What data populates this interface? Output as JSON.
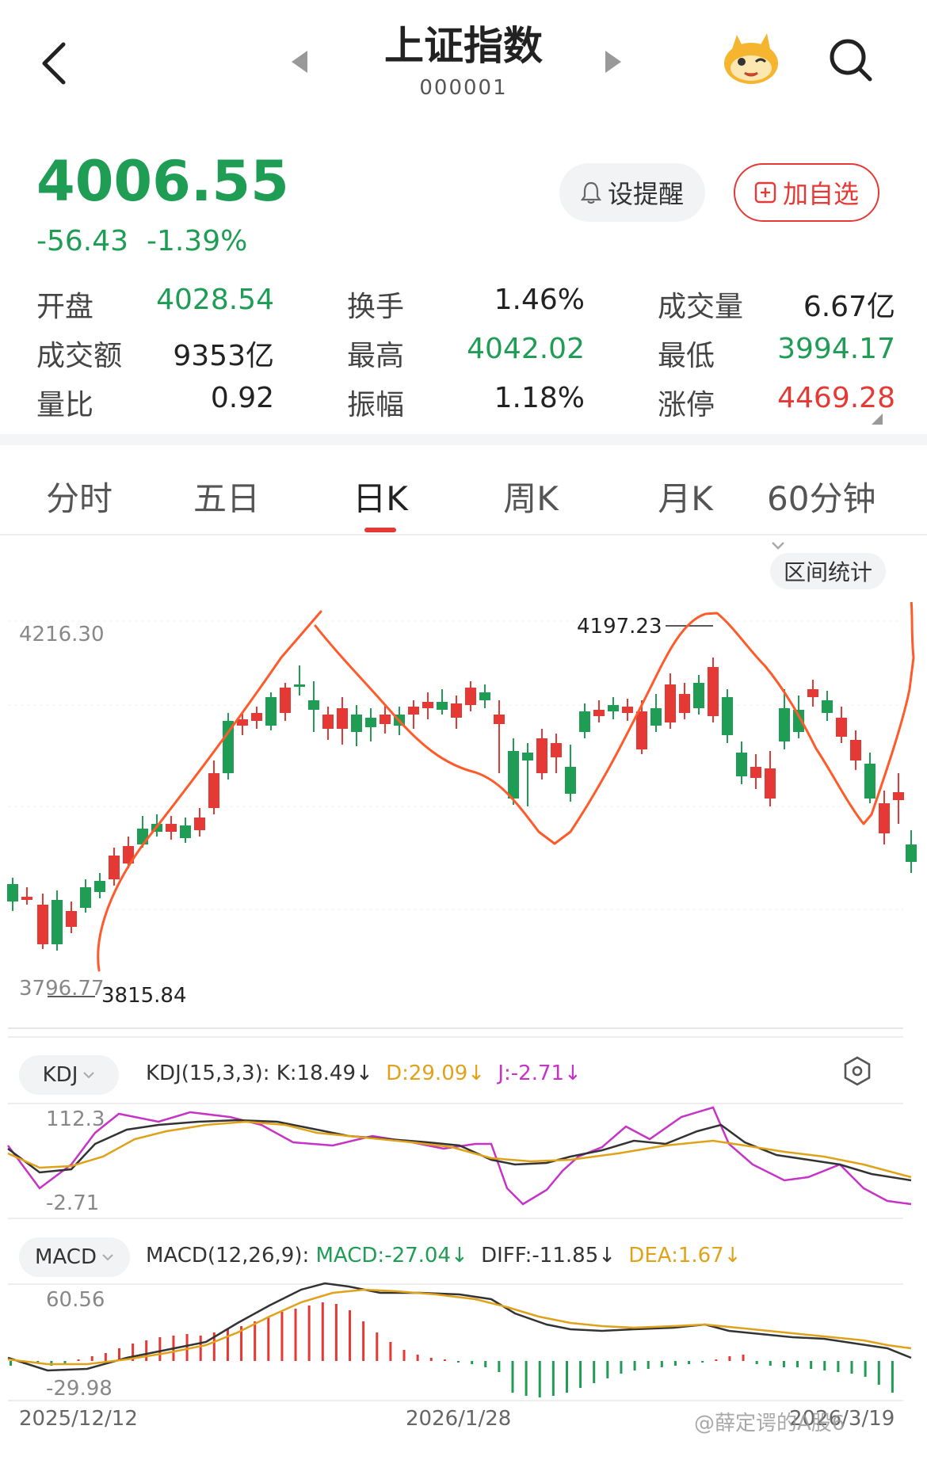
{
  "header": {
    "title": "上证指数",
    "code": "000001"
  },
  "quote": {
    "price": "4006.55",
    "change": "-56.43",
    "change_pct": "-1.39%",
    "alert_label": "设提醒",
    "watch_label": "加自选"
  },
  "stats": [
    {
      "label": "开盘",
      "value": "4028.54",
      "color": "green"
    },
    {
      "label": "换手",
      "value": "1.46%",
      "color": "dark"
    },
    {
      "label": "成交量",
      "value": "6.67亿",
      "color": "dark"
    },
    {
      "label": "成交额",
      "value": "9353亿",
      "color": "dark"
    },
    {
      "label": "最高",
      "value": "4042.02",
      "color": "green"
    },
    {
      "label": "最低",
      "value": "3994.17",
      "color": "green"
    },
    {
      "label": "量比",
      "value": "0.92",
      "color": "dark"
    },
    {
      "label": "振幅",
      "value": "1.18%",
      "color": "dark"
    },
    {
      "label": "涨停",
      "value": "4469.28",
      "color": "red"
    }
  ],
  "tabs": [
    "分时",
    "五日",
    "日K",
    "周K",
    "月K",
    "60分钟"
  ],
  "active_tab": "日K",
  "kline": {
    "range_button": "区间统计",
    "top_label": "4216.30",
    "low_label": "3796.77",
    "low_annotation": "3815.84",
    "high_annotation": "4197.23"
  },
  "kdj": {
    "selector": "KDJ",
    "params": "KDJ(15,3,3):",
    "k": "K:18.49",
    "d": "D:29.09",
    "j": "J:-2.71",
    "top": "112.3",
    "bottom": "-2.71"
  },
  "macd": {
    "selector": "MACD",
    "params": "MACD(12,26,9):",
    "macd": "MACD:-27.04",
    "diff": "DIFF:-11.85",
    "dea": "DEA:1.67",
    "top": "60.56",
    "bottom": "-29.98"
  },
  "dates": [
    "2025/12/12",
    "2026/1/28",
    "2026/3/19"
  ],
  "watermark": "@薛定谔的A股6",
  "colors": {
    "up": "#e53935",
    "down": "#1f9d55",
    "accent": "#e53935"
  }
}
